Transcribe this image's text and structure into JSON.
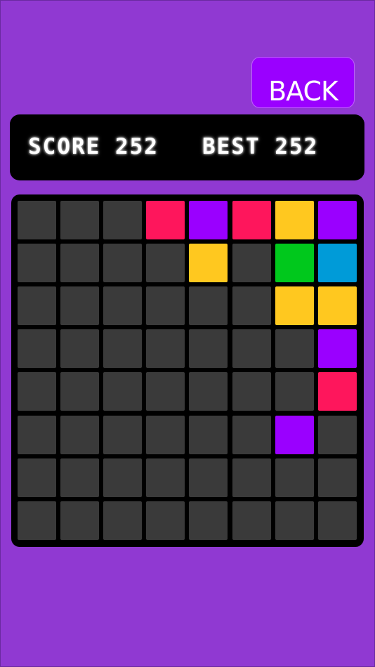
{
  "colors": {
    "background": "#9039d2",
    "back_button": "#9a00ff",
    "panel": "#000000",
    "empty": "#3a3a3a",
    "red": "#fe165c",
    "purple": "#9a00ff",
    "yellow": "#ffc81f",
    "green": "#00c81c",
    "blue": "#009bd8"
  },
  "header": {
    "back_label": "BACK"
  },
  "scores": {
    "score_label": "SCORE 252",
    "best_label": "BEST 252"
  },
  "board": {
    "size": 8,
    "grid": [
      [
        "empty",
        "empty",
        "empty",
        "red",
        "purple",
        "red",
        "yellow",
        "purple"
      ],
      [
        "empty",
        "empty",
        "empty",
        "empty",
        "yellow",
        "empty",
        "green",
        "blue"
      ],
      [
        "empty",
        "empty",
        "empty",
        "empty",
        "empty",
        "empty",
        "yellow",
        "yellow"
      ],
      [
        "empty",
        "empty",
        "empty",
        "empty",
        "empty",
        "empty",
        "empty",
        "purple"
      ],
      [
        "empty",
        "empty",
        "empty",
        "empty",
        "empty",
        "empty",
        "empty",
        "red"
      ],
      [
        "empty",
        "empty",
        "empty",
        "empty",
        "empty",
        "empty",
        "purple",
        "empty"
      ],
      [
        "empty",
        "empty",
        "empty",
        "empty",
        "empty",
        "empty",
        "empty",
        "empty"
      ],
      [
        "empty",
        "empty",
        "empty",
        "empty",
        "empty",
        "empty",
        "empty",
        "empty"
      ]
    ]
  }
}
